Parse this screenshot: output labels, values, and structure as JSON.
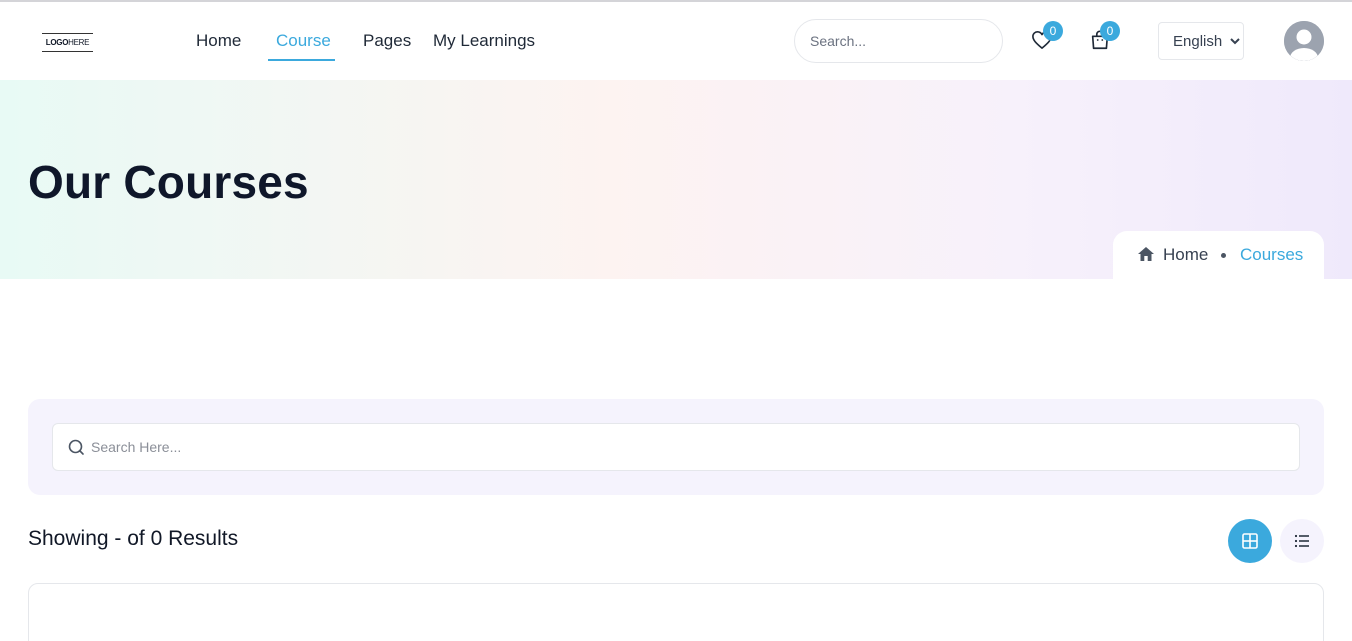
{
  "header": {
    "logo": {
      "bold": "LOGO",
      "light": "HERE"
    },
    "nav": [
      {
        "label": "Home",
        "active": false
      },
      {
        "label": "Course",
        "active": true
      },
      {
        "label": "Pages",
        "active": false
      },
      {
        "label": "My Learnings",
        "active": false
      }
    ],
    "search_placeholder": "Search...",
    "wishlist": {
      "icon": "heart-icon",
      "count": "0"
    },
    "cart": {
      "icon": "shopping-bag-icon",
      "count": "0"
    },
    "language": {
      "selected": "English"
    },
    "avatar_icon": "user-avatar-icon"
  },
  "hero": {
    "title": "Our Courses",
    "breadcrumb": {
      "home_icon": "home-icon",
      "home": "Home",
      "current": "Courses"
    }
  },
  "filter": {
    "search_icon": "search-icon",
    "placeholder": "Search Here..."
  },
  "results": {
    "text": "Showing - of 0 Results"
  },
  "view_toggle": {
    "grid_icon": "grid-view-icon",
    "list_icon": "list-view-icon",
    "active": "grid"
  },
  "colors": {
    "accent": "#3ba9dd",
    "panel": "#f5f3fd",
    "text": "#0f172a"
  }
}
